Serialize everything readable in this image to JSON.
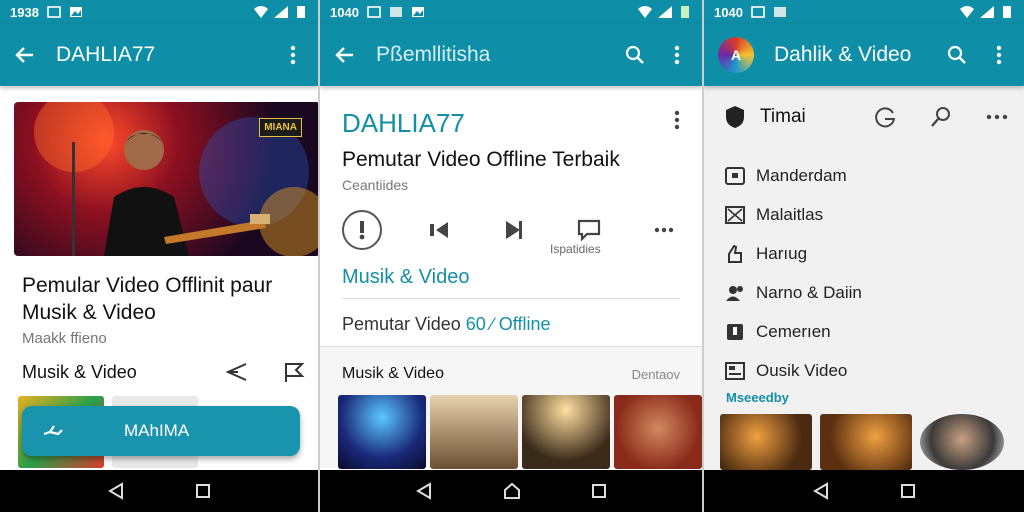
{
  "panels": [
    {
      "status_time": "1938",
      "title": "DAHLIA77",
      "hero_badge": "MIANA",
      "app_title": "Pemular Video Offlinit paur Musik & Video",
      "subtitle": "Maakk ffieno",
      "section_label": "Musik & Video",
      "fab_label": "MAhIMA"
    },
    {
      "status_time": "1040",
      "title": "Pßemllitisha",
      "brand": "DAHLIA77",
      "app_title": "Pemutar Video Offline Terbaik",
      "category": "Ceantiides",
      "action_caption": "Ispatidies",
      "category_link": "Musik & Video",
      "desc_prefix": "Pemutar Video ",
      "desc_highlight": "60 ∕ Offline",
      "section_title": "Musik & Video",
      "section_right": "Dentaov"
    },
    {
      "status_time": "1040",
      "title": "Dahlik & Video",
      "head_label": "Timai",
      "menu": [
        {
          "label": "Manderdam",
          "icon": "tv-icon"
        },
        {
          "label": "Malaitlas",
          "icon": "image-icon"
        },
        {
          "label": "Harıug",
          "icon": "thumb-icon"
        },
        {
          "label": "Narno & Daiin",
          "icon": "people-icon"
        },
        {
          "label": "Cemerıen",
          "icon": "bookmark-icon"
        },
        {
          "label": "Ousik Video",
          "icon": "video-list-icon"
        }
      ],
      "section_label": "Mseeedby"
    }
  ],
  "colors": {
    "toolbar": "#0e8ea7",
    "accent": "#138fa8",
    "fab": "#1a93ad",
    "navbar": "#000000"
  }
}
